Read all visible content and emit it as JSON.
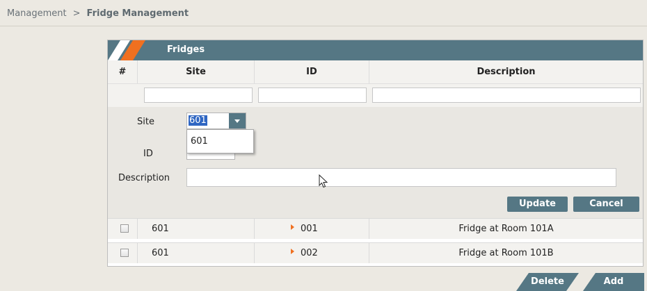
{
  "breadcrumb": {
    "parent": "Management",
    "separator": ">",
    "current": "Fridge Management"
  },
  "panel": {
    "title": "Fridges"
  },
  "columns": {
    "num": "#",
    "site": "Site",
    "id": "ID",
    "description": "Description"
  },
  "edit": {
    "site_label": "Site",
    "site_value": "601",
    "site_options": [
      "601"
    ],
    "id_label": "ID",
    "description_label": "Description",
    "update_label": "Update",
    "cancel_label": "Cancel"
  },
  "rows": [
    {
      "site": "601",
      "id": "001",
      "description": "Fridge at Room 101A"
    },
    {
      "site": "601",
      "id": "002",
      "description": "Fridge at Room 101B"
    }
  ],
  "actions": {
    "delete_label": "Delete",
    "add_label": "Add"
  },
  "colors": {
    "accent_teal": "#557784",
    "accent_orange": "#f07020",
    "selection_blue": "#2f66c2"
  },
  "icons": {
    "row_marker": "caret-right-icon",
    "dropdown": "chevron-down-icon",
    "cursor": "mouse-pointer-icon"
  }
}
